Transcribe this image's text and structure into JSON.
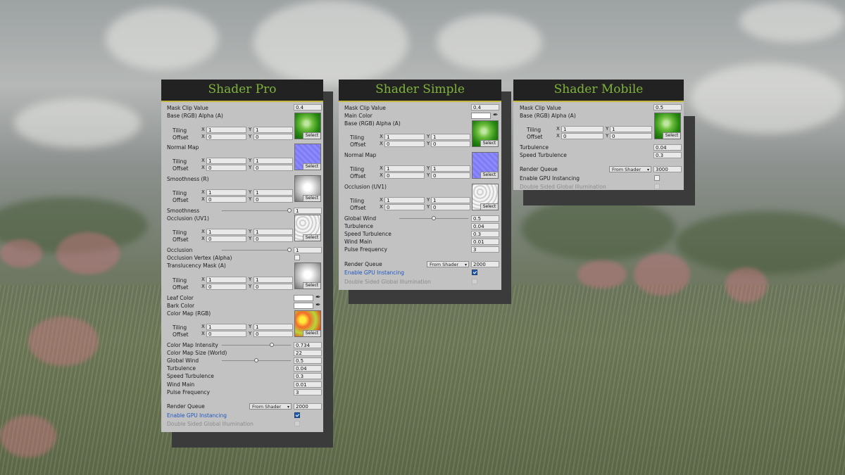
{
  "shared": {
    "tiling_label": "Tiling",
    "offset_label": "Offset",
    "x_axis": "X",
    "y_axis": "Y",
    "select_label": "Select",
    "render_queue_label": "Render Queue",
    "render_queue_option": "From Shader",
    "gpu_label": "Enable GPU Instancing",
    "dsgi_label": "Double Sided Global Illumination",
    "picker_icon": "eyedropper-icon",
    "checkbox_icon": "checkmark-icon"
  },
  "pro": {
    "title": "Shader Pro",
    "mask_clip_label": "Mask Clip Value",
    "mask_clip_value": "0.4",
    "base_label": "Base (RGB) Alpha (A)",
    "base_tiling": [
      "1",
      "1"
    ],
    "base_offset": [
      "0",
      "0"
    ],
    "normal_label": "Normal Map",
    "normal_tiling": [
      "1",
      "1"
    ],
    "normal_offset": [
      "0",
      "0"
    ],
    "smooth_tex_label": "Smoothness (R)",
    "smooth_tiling": [
      "1",
      "1"
    ],
    "smooth_offset": [
      "0",
      "0"
    ],
    "smoothness_label": "Smoothness",
    "smoothness_value": "1",
    "occ_tex_label": "Occlusion (UV1)",
    "occ_tiling": [
      "1",
      "1"
    ],
    "occ_offset": [
      "0",
      "0"
    ],
    "occlusion_label": "Occlusion",
    "occlusion_value": "1",
    "occ_vertex_label": "Occlusion Vertex (Alpha)",
    "transl_label": "Translucency Mask (A)",
    "transl_tiling": [
      "1",
      "1"
    ],
    "transl_offset": [
      "0",
      "0"
    ],
    "leaf_color_label": "Leaf Color",
    "bark_color_label": "Bark Color",
    "cmap_label": "Color Map (RGB)",
    "cmap_tiling": [
      "1",
      "1"
    ],
    "cmap_offset": [
      "0",
      "0"
    ],
    "cmap_intensity_label": "Color Map Intensity",
    "cmap_intensity_value": "0.734",
    "cmap_size_label": "Color Map Size (World)",
    "cmap_size_value": "22",
    "wind_label": "Global Wind",
    "wind_value": "0.5",
    "turb_label": "Turbulence",
    "turb_value": "0.04",
    "speed_turb_label": "Speed Turbulence",
    "speed_turb_value": "0.3",
    "wind_main_label": "Wind Main",
    "wind_main_value": "0.01",
    "pulse_label": "Pulse Frequency",
    "pulse_value": "3",
    "render_queue_value": "2000",
    "gpu_checked": true
  },
  "simple": {
    "title": "Shader Simple",
    "mask_clip_label": "Mask Clip Value",
    "mask_clip_value": "0.4",
    "main_color_label": "Main Color",
    "base_label": "Base (RGB) Alpha (A)",
    "base_tiling": [
      "1",
      "1"
    ],
    "base_offset": [
      "0",
      "0"
    ],
    "normal_label": "Normal Map",
    "normal_tiling": [
      "1",
      "1"
    ],
    "normal_offset": [
      "0",
      "0"
    ],
    "occ_tex_label": "Occlusion (UV1)",
    "occ_tiling": [
      "1",
      "1"
    ],
    "occ_offset": [
      "0",
      "0"
    ],
    "wind_label": "Global Wind",
    "wind_value": "0.5",
    "turb_label": "Turbulence",
    "turb_value": "0.04",
    "speed_turb_label": "Speed Turbulence",
    "speed_turb_value": "0.3",
    "wind_main_label": "Wind Main",
    "wind_main_value": "0.01",
    "pulse_label": "Pulse Frequency",
    "pulse_value": "3",
    "render_queue_value": "2000",
    "gpu_checked": true
  },
  "mobile": {
    "title": "Shader Mobile",
    "mask_clip_label": "Mask Clip Value",
    "mask_clip_value": "0.5",
    "base_label": "Base (RGB) Alpha (A)",
    "base_tiling": [
      "1",
      "1"
    ],
    "base_offset": [
      "0",
      "0"
    ],
    "turb_label": "Turbulence",
    "turb_value": "0.04",
    "speed_turb_label": "Speed Turbulence",
    "speed_turb_value": "0.3",
    "render_queue_value": "3000",
    "gpu_checked": false
  }
}
